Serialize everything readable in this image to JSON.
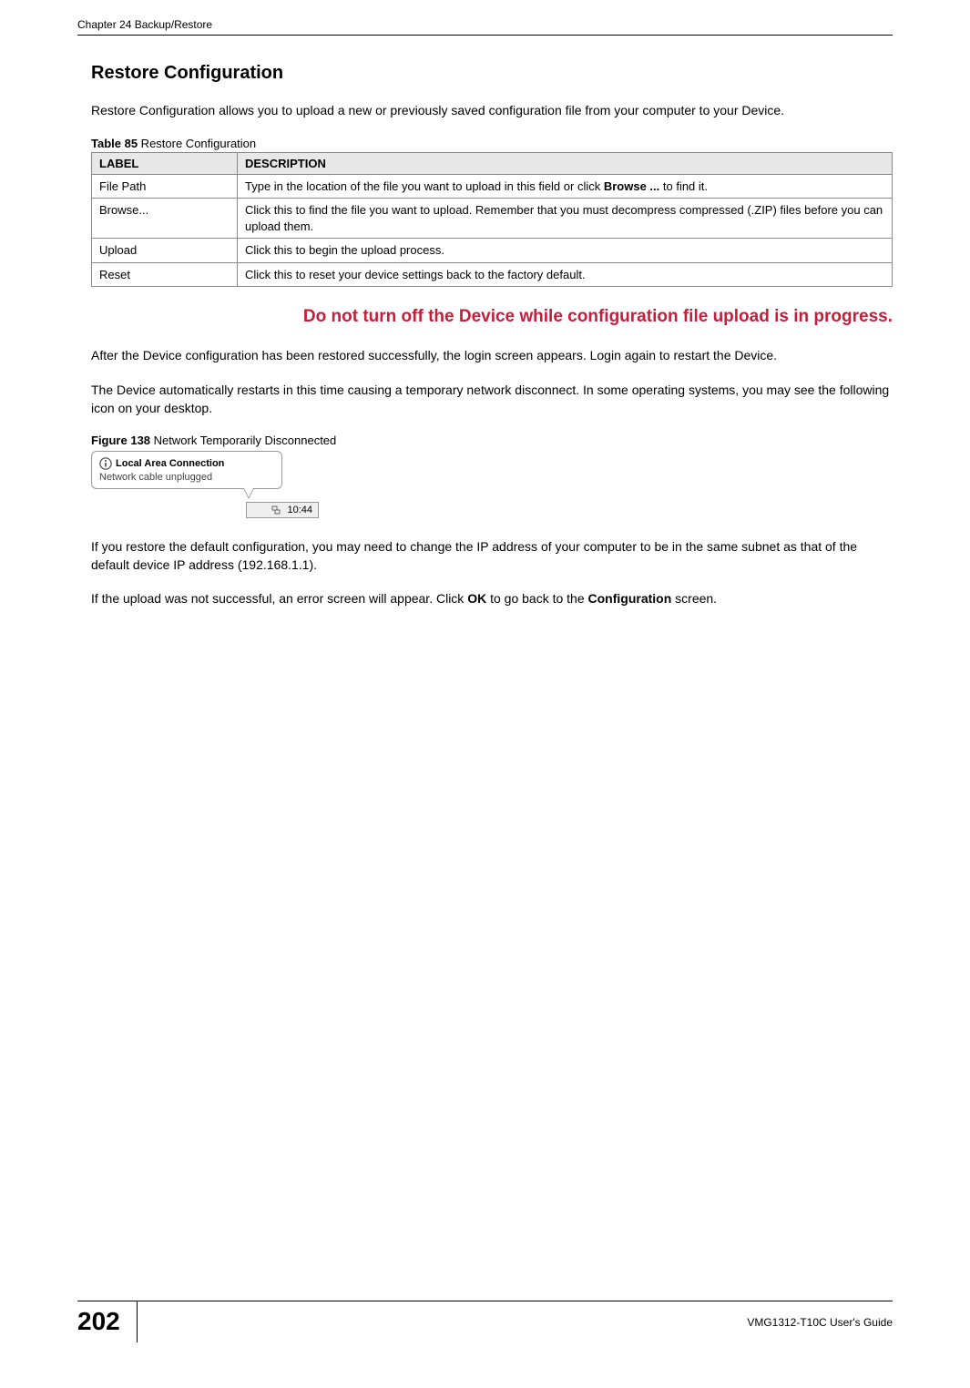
{
  "header": {
    "chapter": "Chapter 24 Backup/Restore"
  },
  "section": {
    "title": "Restore Configuration",
    "intro": "Restore Configuration allows you to upload a new or previously saved configuration file from your computer to your Device."
  },
  "table": {
    "caption_bold": "Table 85",
    "caption_rest": "   Restore Configuration",
    "headers": {
      "label": "LABEL",
      "description": "DESCRIPTION"
    },
    "rows": [
      {
        "label": "File Path",
        "desc_before": "Type in the location of the file you want to upload in this field or click ",
        "desc_bold": "Browse ...",
        "desc_after": " to find it."
      },
      {
        "label": "Browse...",
        "desc_before": "Click this to find the file you want to upload. Remember that you must decompress compressed (.ZIP) files before you can upload them.",
        "desc_bold": "",
        "desc_after": ""
      },
      {
        "label": "Upload",
        "desc_before": "Click this to begin the upload process.",
        "desc_bold": "",
        "desc_after": ""
      },
      {
        "label": "Reset",
        "desc_before": "Click this to reset your device settings back to the factory default.",
        "desc_bold": "",
        "desc_after": ""
      }
    ]
  },
  "warning": "Do not turn off the Device while configuration file upload is in progress.",
  "post_text": {
    "p1": "After the Device configuration has been restored successfully, the login screen appears. Login again to restart the Device.",
    "p2": "The Device automatically restarts in this time causing a temporary network disconnect. In some operating systems, you may see the following icon on your desktop."
  },
  "figure": {
    "caption_bold": "Figure 138",
    "caption_rest": "   Network Temporarily Disconnected",
    "balloon_title": "Local Area Connection",
    "balloon_msg": "Network cable unplugged",
    "tray_time": "10:44"
  },
  "post_figure": {
    "p1": "If you restore the default configuration, you may need to change the IP address of your computer to be in the same subnet as that of the default device IP address (192.168.1.1).",
    "p2_a": "If the upload was not successful, an error screen will appear. Click ",
    "p2_b1": "OK",
    "p2_c": " to go back to the ",
    "p2_b2": "Configuration",
    "p2_d": " screen."
  },
  "footer": {
    "page": "202",
    "guide": "VMG1312-T10C User's Guide"
  }
}
